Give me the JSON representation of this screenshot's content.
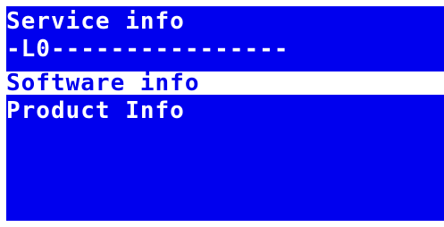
{
  "colors": {
    "screen_background": "#0000ee",
    "text": "#ffffff",
    "highlight_background": "#ffffff",
    "highlight_text": "#0000ee"
  },
  "screen": {
    "title": "Service info",
    "separator": "-L0----------------",
    "menu": {
      "items": [
        {
          "label": "Software info",
          "selected": true
        },
        {
          "label": "Product Info",
          "selected": false
        }
      ]
    }
  }
}
